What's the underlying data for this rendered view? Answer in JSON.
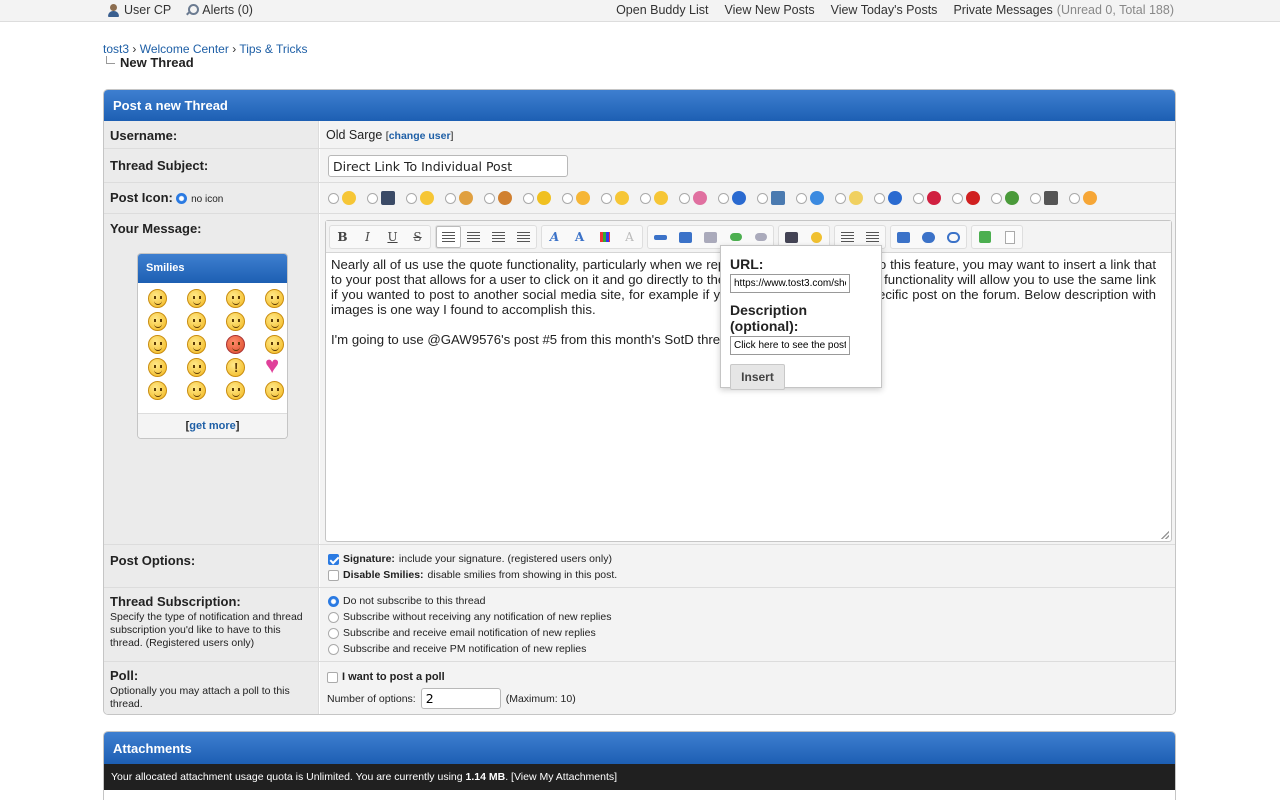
{
  "topbar": {
    "user_cp": "User CP",
    "alerts": "Alerts (0)",
    "buddy_list": "Open Buddy List",
    "new_posts": "View New Posts",
    "todays_posts": "View Today's Posts",
    "private_messages": "Private Messages",
    "pm_counts": "(Unread 0, Total 188)"
  },
  "breadcrumb": {
    "items": [
      "tost3",
      "Welcome Center",
      "Tips & Tricks"
    ],
    "separator": "›",
    "current": "New Thread"
  },
  "form": {
    "header": "Post a new Thread",
    "username_label": "Username:",
    "username_value": "Old Sarge",
    "change_user_link": "change user",
    "subject_label": "Thread Subject:",
    "subject_value": "Direct Link To Individual Post",
    "post_icon_label": "Post Icon:",
    "no_icon_label": "no icon",
    "message_label": "Your Message:",
    "post_icons": [
      "smile-icon",
      "film-icon",
      "grin-icon",
      "thumbs-up-icon",
      "thumbs-down-icon",
      "star-icon",
      "angry-icon",
      "frown-icon",
      "wink-icon",
      "rainbow-icon",
      "question-icon",
      "image-icon",
      "music-icon",
      "lightbulb-icon",
      "info-icon",
      "heart-icon",
      "exclamation-icon",
      "bug-icon",
      "clapper-icon",
      "laugh-icon"
    ]
  },
  "smilies": {
    "title": "Smilies",
    "get_more": "get more"
  },
  "editor": {
    "paragraph1": "Nearly all of us use the quote functionality, particularly when we reply t                                a to this feature, you may want to insert a link that to your post that allows for a user to click on it and go directly to the p                                 this functionality will allow you to use the same link if you wanted to post to another social media site, for example if yo                                  pecific post on the forum. Below description with images is one way I found to accomplish this.",
    "paragraph2": "I'm going to use @GAW9576's post #5 from this month's SotD thread."
  },
  "link_popup": {
    "url_label": "URL:",
    "url_value": "https://www.tost3.com/sho",
    "desc_label": "Description (optional):",
    "desc_value": "Click here to see the post",
    "insert_label": "Insert"
  },
  "post_options": {
    "label": "Post Options:",
    "signature_bold": "Signature:",
    "signature_text": "include your signature. (registered users only)",
    "disable_smilies_bold": "Disable Smilies:",
    "disable_smilies_text": "disable smilies from showing in this post."
  },
  "subscription": {
    "label": "Thread Subscription:",
    "desc": "Specify the type of notification and thread subscription you'd like to have to this thread. (Registered users only)",
    "options": [
      "Do not subscribe to this thread",
      "Subscribe without receiving any notification of new replies",
      "Subscribe and receive email notification of new replies",
      "Subscribe and receive PM notification of new replies"
    ]
  },
  "poll": {
    "label": "Poll:",
    "desc": "Optionally you may attach a poll to this thread.",
    "checkbox_label": "I want to post a poll",
    "num_options_label": "Number of options:",
    "num_options_value": "2",
    "maximum": "(Maximum: 10)"
  },
  "attachments": {
    "header": "Attachments",
    "quota_text": "Your allocated attachment usage quota is Unlimited. You are currently using",
    "usage": "1.14 MB",
    "period": ".",
    "view_link": "[View My Attachments]"
  },
  "colors": {
    "header_blue": "#1d5fb3",
    "link_blue": "#1e5fa6",
    "radio_blue": "#2a7ae2"
  }
}
